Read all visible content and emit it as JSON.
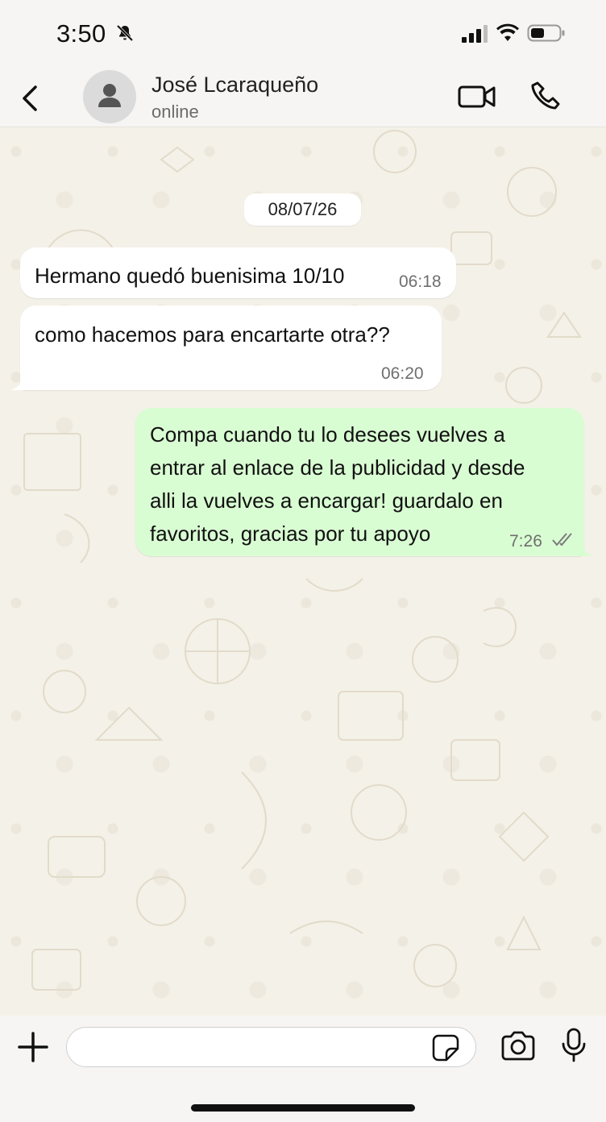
{
  "status_bar": {
    "time": "3:50",
    "icons": [
      "bell-slash-icon",
      "signal-icon",
      "wifi-icon",
      "battery-icon"
    ]
  },
  "header": {
    "contact_name": "José Lcaraqueño",
    "contact_status": "online",
    "icons": [
      "back-chevron-icon",
      "avatar-person-icon",
      "video-call-icon",
      "phone-call-icon"
    ]
  },
  "chat": {
    "date_chip": "08/07/26",
    "incoming": [
      {
        "text": "Hermano quedó buenisima 10/10",
        "time": "06:18"
      },
      {
        "text": "como hacemos para encartarte otra??",
        "time": "06:20"
      }
    ],
    "outgoing": [
      {
        "lines": [
          "Compa cuando tu lo desees vuelves a",
          "entrar al enlace de la publicidad y desde",
          "alli la vuelves a encargar! guardalo en",
          "favoritos, gracias por tu apoyo"
        ],
        "time": "7:26",
        "status_icon": "double-check-icon"
      }
    ]
  },
  "input_bar": {
    "placeholder": "",
    "icons": [
      "plus-icon",
      "sticker-icon",
      "camera-icon",
      "microphone-icon"
    ]
  },
  "colors": {
    "chat_background": "#f4f1e8",
    "incoming_bubble": "#ffffff",
    "outgoing_bubble": "#d9fdd3",
    "header_background": "#f6f5f3"
  }
}
